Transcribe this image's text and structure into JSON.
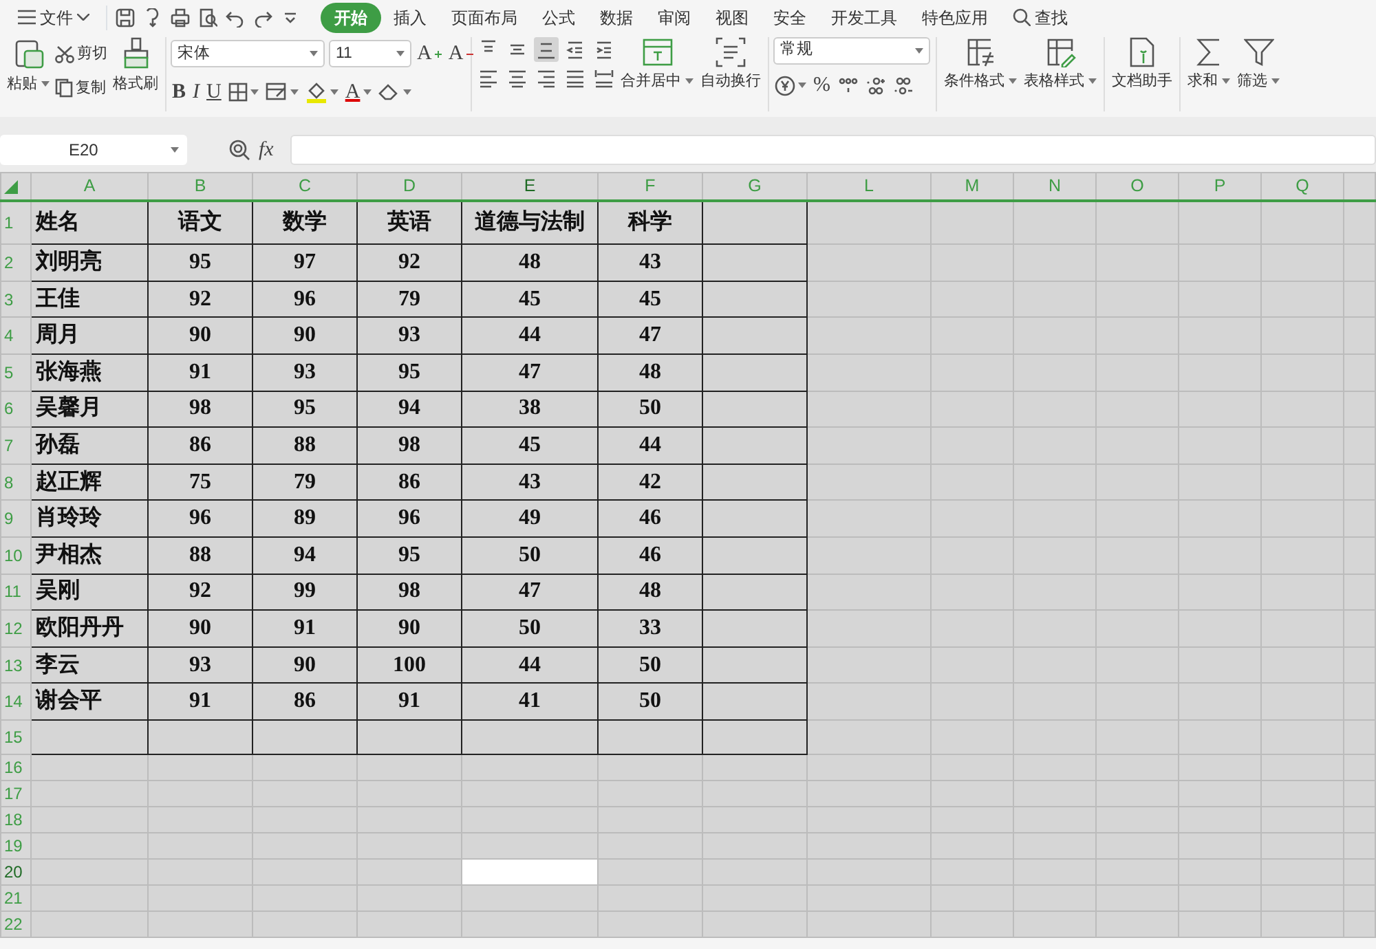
{
  "file_menu": "文件",
  "tabs": [
    {
      "label": "开始",
      "selected": true
    },
    {
      "label": "插入",
      "selected": false
    },
    {
      "label": "页面布局",
      "selected": false
    },
    {
      "label": "公式",
      "selected": false
    },
    {
      "label": "数据",
      "selected": false
    },
    {
      "label": "审阅",
      "selected": false
    },
    {
      "label": "视图",
      "selected": false
    },
    {
      "label": "安全",
      "selected": false
    },
    {
      "label": "开发工具",
      "selected": false
    },
    {
      "label": "特色应用",
      "selected": false
    }
  ],
  "search": "查找",
  "ribbon": {
    "paste": "粘贴",
    "cut": "剪切",
    "copy": "复制",
    "format_painter": "格式刷",
    "font": "宋体",
    "font_size": "11",
    "grow_font": "A",
    "shrink_font": "A",
    "style_buttons": [
      "B",
      "I",
      "U"
    ],
    "font_color": "A",
    "align_buttons": [
      {
        "kind": "top",
        "selected": false
      },
      {
        "kind": "middle",
        "selected": false
      },
      {
        "kind": "bottom",
        "selected": true
      },
      {
        "kind": "outdent",
        "selected": false
      },
      {
        "kind": "indent",
        "selected": false
      },
      {
        "kind": "left",
        "selected": false
      },
      {
        "kind": "center",
        "selected": false
      },
      {
        "kind": "right",
        "selected": false
      },
      {
        "kind": "justify",
        "selected": false
      },
      {
        "kind": "distributed",
        "selected": false
      }
    ],
    "merge": "合并居中",
    "wrap": "自动换行",
    "number_format": "常规",
    "percent": "%",
    "conditional_format": "条件格式",
    "table_style": "表格样式",
    "doc_assistant": "文档助手",
    "sum": "求和",
    "filter": "筛选"
  },
  "formula_bar": {
    "name_box": "E20",
    "fx": "fx"
  },
  "sheet": {
    "columns": [
      {
        "label": "A",
        "selected": false
      },
      {
        "label": "B",
        "selected": false
      },
      {
        "label": "C",
        "selected": false
      },
      {
        "label": "D",
        "selected": false
      },
      {
        "label": "E",
        "selected": true
      },
      {
        "label": "F",
        "selected": false
      },
      {
        "label": "G",
        "selected": false
      },
      {
        "label": "L",
        "selected": false
      },
      {
        "label": "M",
        "selected": false
      },
      {
        "label": "N",
        "selected": false
      },
      {
        "label": "O",
        "selected": false
      },
      {
        "label": "P",
        "selected": false
      },
      {
        "label": "Q",
        "selected": false
      }
    ],
    "rows": [
      {
        "number": "1",
        "kind": "header",
        "bordered": true,
        "selected": false,
        "cells": [
          "姓名",
          "语文",
          "数学",
          "英语",
          "道德与法制",
          "科学"
        ]
      },
      {
        "number": "2",
        "kind": "data",
        "bordered": true,
        "selected": false,
        "cells": [
          "刘明亮",
          "95",
          "97",
          "92",
          "48",
          "43"
        ]
      },
      {
        "number": "3",
        "kind": "data",
        "bordered": true,
        "selected": false,
        "cells": [
          "王佳",
          "92",
          "96",
          "79",
          "45",
          "45"
        ]
      },
      {
        "number": "4",
        "kind": "data",
        "bordered": true,
        "selected": false,
        "cells": [
          "周月",
          "90",
          "90",
          "93",
          "44",
          "47"
        ]
      },
      {
        "number": "5",
        "kind": "data",
        "bordered": true,
        "selected": false,
        "cells": [
          "张海燕",
          "91",
          "93",
          "95",
          "47",
          "48"
        ]
      },
      {
        "number": "6",
        "kind": "data",
        "bordered": true,
        "selected": false,
        "cells": [
          "吴馨月",
          "98",
          "95",
          "94",
          "38",
          "50"
        ]
      },
      {
        "number": "7",
        "kind": "data",
        "bordered": true,
        "selected": false,
        "cells": [
          "孙磊",
          "86",
          "88",
          "98",
          "45",
          "44"
        ]
      },
      {
        "number": "8",
        "kind": "data",
        "bordered": true,
        "selected": false,
        "cells": [
          "赵正辉",
          "75",
          "79",
          "86",
          "43",
          "42"
        ]
      },
      {
        "number": "9",
        "kind": "data",
        "bordered": true,
        "selected": false,
        "cells": [
          "肖玲玲",
          "96",
          "89",
          "96",
          "49",
          "46"
        ]
      },
      {
        "number": "10",
        "kind": "data",
        "bordered": true,
        "selected": false,
        "cells": [
          "尹相杰",
          "88",
          "94",
          "95",
          "50",
          "46"
        ]
      },
      {
        "number": "11",
        "kind": "data",
        "bordered": true,
        "selected": false,
        "cells": [
          "吴刚",
          "92",
          "99",
          "98",
          "47",
          "48"
        ]
      },
      {
        "number": "12",
        "kind": "data",
        "bordered": true,
        "selected": false,
        "cells": [
          "欧阳丹丹",
          "90",
          "91",
          "90",
          "50",
          "33"
        ]
      },
      {
        "number": "13",
        "kind": "data",
        "bordered": true,
        "selected": false,
        "cells": [
          "李云",
          "93",
          "90",
          "100",
          "44",
          "50"
        ]
      },
      {
        "number": "14",
        "kind": "data",
        "bordered": true,
        "selected": false,
        "cells": [
          "谢会平",
          "91",
          "86",
          "91",
          "41",
          "50"
        ]
      },
      {
        "number": "15",
        "kind": "blank",
        "bordered": true,
        "selected": false
      },
      {
        "number": "16",
        "kind": "blank",
        "bordered": false,
        "selected": false
      },
      {
        "number": "17",
        "kind": "blank",
        "bordered": false,
        "selected": false
      },
      {
        "number": "18",
        "kind": "blank",
        "bordered": false,
        "selected": false
      },
      {
        "number": "19",
        "kind": "blank",
        "bordered": false,
        "selected": false
      },
      {
        "number": "20",
        "kind": "blank",
        "bordered": false,
        "selected": true
      },
      {
        "number": "21",
        "kind": "blank",
        "bordered": false,
        "selected": false
      },
      {
        "number": "22",
        "kind": "blank",
        "bordered": false,
        "selected": false
      }
    ]
  }
}
